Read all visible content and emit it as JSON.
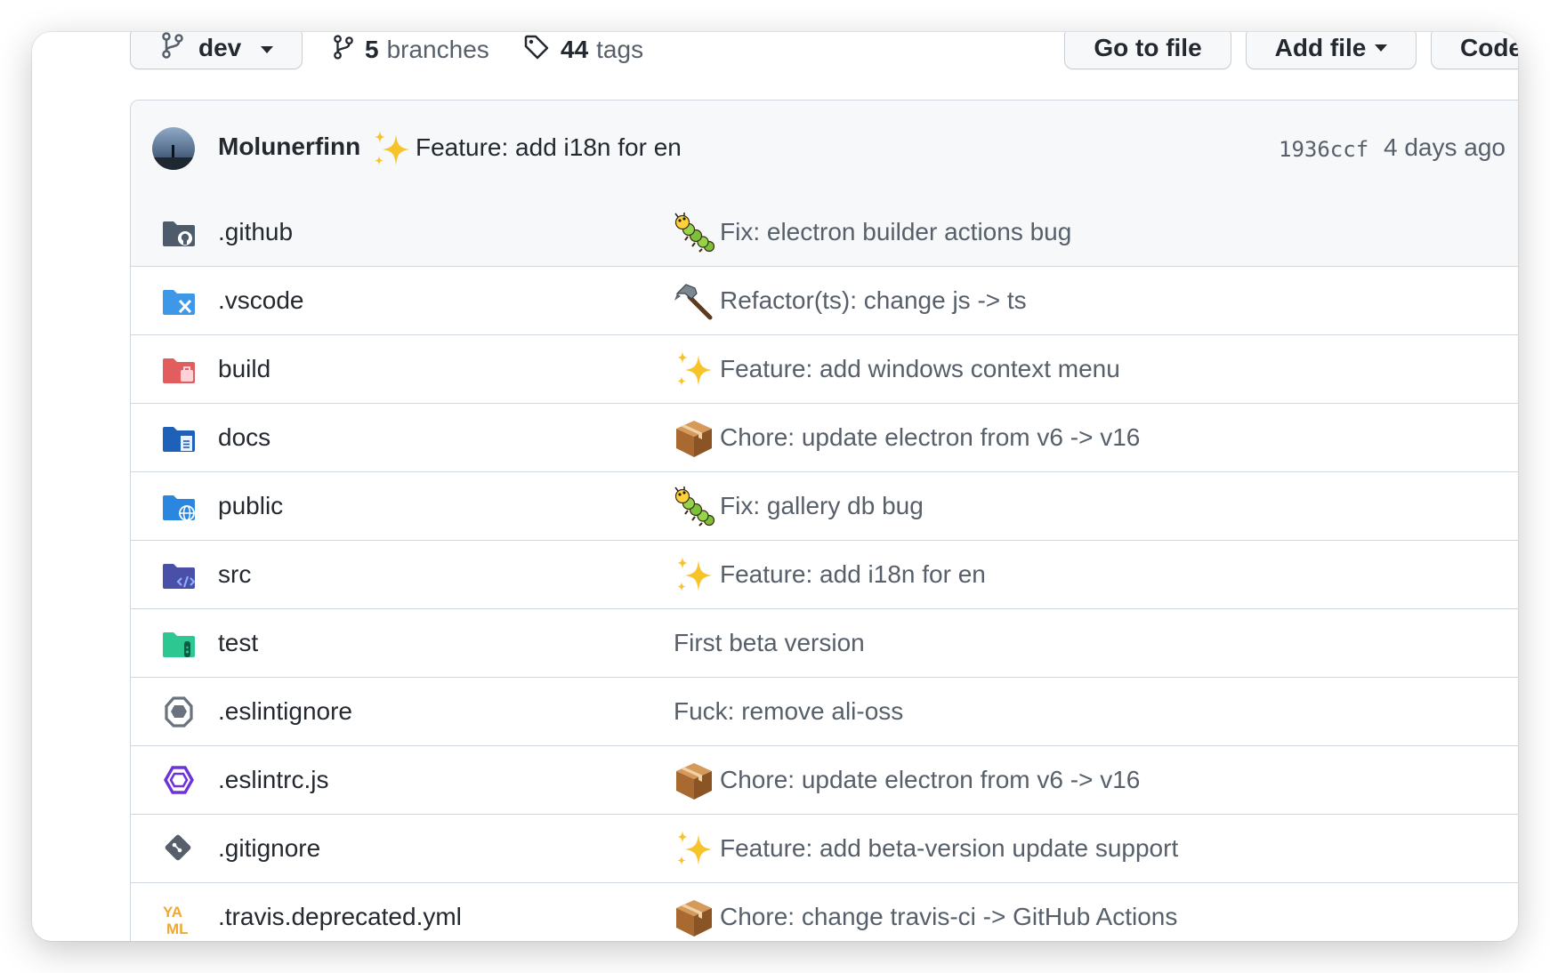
{
  "toolbar": {
    "branch": "dev",
    "branches_count": "5",
    "branches_label": "branches",
    "tags_count": "44",
    "tags_label": "tags",
    "goto_label": "Go to file",
    "addfile_label": "Add file",
    "code_label": "Code"
  },
  "latest_commit": {
    "author": "Molunerfinn",
    "message": "Feature: add i18n for en",
    "sha": "1936ccf",
    "ago": "4 days ago"
  },
  "files": [
    {
      "name": ".github",
      "icon": "folder-github-icon",
      "emoji": "bug",
      "message": "Fix: electron builder actions bug"
    },
    {
      "name": ".vscode",
      "icon": "folder-vscode-icon",
      "emoji": "hammer",
      "message": "Refactor(ts): change js -> ts"
    },
    {
      "name": "build",
      "icon": "folder-build-icon",
      "emoji": "sparkles",
      "message": "Feature: add windows context menu"
    },
    {
      "name": "docs",
      "icon": "folder-docs-icon",
      "emoji": "package",
      "message": "Chore: update electron from v6 -> v16"
    },
    {
      "name": "public",
      "icon": "folder-public-icon",
      "emoji": "bug",
      "message": "Fix: gallery db bug"
    },
    {
      "name": "src",
      "icon": "folder-src-icon",
      "emoji": "sparkles",
      "message": "Feature: add i18n for en"
    },
    {
      "name": "test",
      "icon": "folder-test-icon",
      "emoji": "",
      "message": "First beta version"
    },
    {
      "name": ".eslintignore",
      "icon": "eslintignore-icon",
      "emoji": "",
      "message": "Fuck: remove ali-oss"
    },
    {
      "name": ".eslintrc.js",
      "icon": "eslint-icon",
      "emoji": "package",
      "message": "Chore: update electron from v6 -> v16"
    },
    {
      "name": ".gitignore",
      "icon": "git-icon",
      "emoji": "sparkles",
      "message": "Feature: add beta-version update support"
    },
    {
      "name": ".travis.deprecated.yml",
      "icon": "yaml-icon",
      "emoji": "package",
      "message": "Chore: change travis-ci -> GitHub Actions"
    }
  ],
  "colors": {
    "border": "#d0d7de",
    "header_bg": "#f6f8fa",
    "text": "#24292f",
    "muted": "#57606a"
  }
}
